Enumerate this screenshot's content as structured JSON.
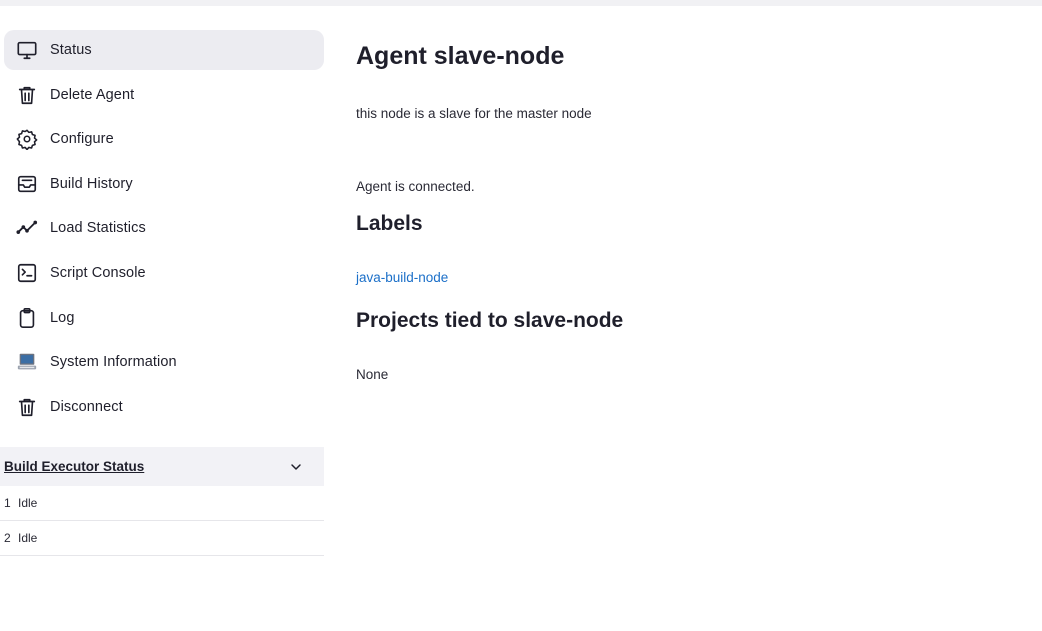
{
  "sidebar": {
    "items": [
      {
        "label": "Status",
        "icon": "monitor-icon"
      },
      {
        "label": "Delete Agent",
        "icon": "trash-icon"
      },
      {
        "label": "Configure",
        "icon": "gear-icon"
      },
      {
        "label": "Build History",
        "icon": "inbox-icon"
      },
      {
        "label": "Load Statistics",
        "icon": "line-chart-icon"
      },
      {
        "label": "Script Console",
        "icon": "terminal-icon"
      },
      {
        "label": "Log",
        "icon": "clipboard-icon"
      },
      {
        "label": "System Information",
        "icon": "computer-icon"
      },
      {
        "label": "Disconnect",
        "icon": "trash-icon"
      }
    ]
  },
  "executors": {
    "title": "Build Executor Status",
    "rows": [
      {
        "num": "1",
        "status": "Idle"
      },
      {
        "num": "2",
        "status": "Idle"
      }
    ]
  },
  "main": {
    "title": "Agent slave-node",
    "description": "this node is a slave for the master node",
    "connection_status": "Agent is connected.",
    "labels_heading": "Labels",
    "label_link": "java-build-node",
    "projects_heading": "Projects tied to slave-node",
    "projects_value": "None"
  },
  "colors": {
    "active_bg": "#ececf1",
    "link": "#1b6fc8",
    "text": "#1f1f2b"
  }
}
